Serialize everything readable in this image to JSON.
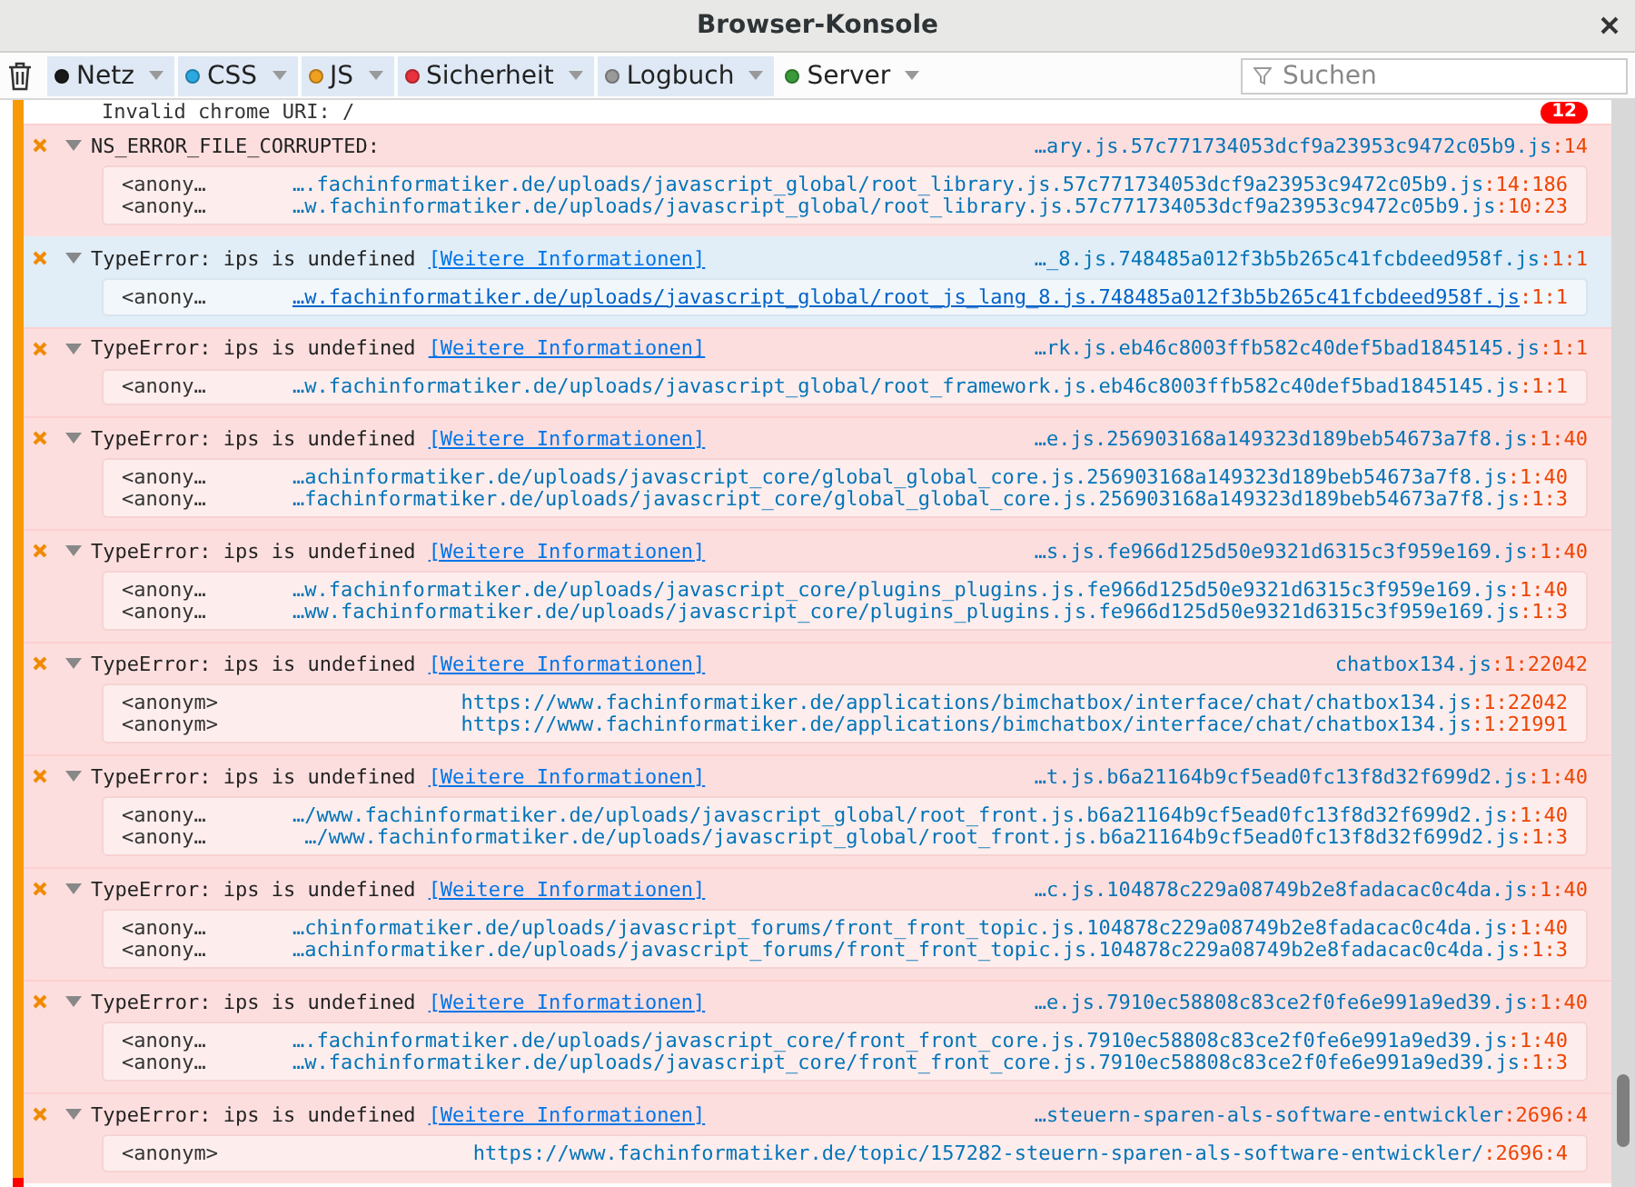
{
  "window": {
    "title": "Browser-Konsole"
  },
  "toolbar": {
    "filters": [
      {
        "label": "Netz",
        "color": "#1a1a1a",
        "selected": true
      },
      {
        "label": "CSS",
        "color": "#2aa8e0",
        "selected": true
      },
      {
        "label": "JS",
        "color": "#f0a020",
        "selected": true
      },
      {
        "label": "Sicherheit",
        "color": "#e8323c",
        "selected": true
      },
      {
        "label": "Logbuch",
        "color": "#9a9a9a",
        "selected": true
      },
      {
        "label": "Server",
        "color": "#3a9a3a",
        "selected": false
      }
    ],
    "search": {
      "placeholder": "Suchen"
    }
  },
  "previous_message": {
    "text": "Invalid chrome URI: /",
    "count": "12"
  },
  "messages": [
    {
      "text": "NS_ERROR_FILE_CORRUPTED:",
      "selected": false,
      "location": {
        "file": "…ary.js.57c771734053dcf9a23953c9472c05b9.js",
        "pos": ":14"
      },
      "stack": [
        {
          "function": "<anony…",
          "file": "….fachinformatiker.de/uploads/javascript_global/root_library.js.57c771734053dcf9a23953c9472c05b9.js",
          "pos": ":14:186"
        },
        {
          "function": "<anony…",
          "file": "…w.fachinformatiker.de/uploads/javascript_global/root_library.js.57c771734053dcf9a23953c9472c05b9.js",
          "pos": ":10:23"
        }
      ]
    },
    {
      "text": "TypeError: ips is undefined",
      "link": "[Weitere Informationen]",
      "selected": true,
      "location": {
        "file": "…_8.js.748485a012f3b5b265c41fcbdeed958f.js",
        "pos": ":1:1"
      },
      "stack": [
        {
          "function": "<anony…",
          "file": "…w.fachinformatiker.de/uploads/javascript_global/root_js_lang_8.js.748485a012f3b5b265c41fcbdeed958f.js",
          "pos": ":1:1"
        }
      ]
    },
    {
      "text": "TypeError: ips is undefined",
      "link": "[Weitere Informationen]",
      "selected": false,
      "location": {
        "file": "…rk.js.eb46c8003ffb582c40def5bad1845145.js",
        "pos": ":1:1"
      },
      "stack": [
        {
          "function": "<anony…",
          "file": "…w.fachinformatiker.de/uploads/javascript_global/root_framework.js.eb46c8003ffb582c40def5bad1845145.js",
          "pos": ":1:1"
        }
      ]
    },
    {
      "text": "TypeError: ips is undefined",
      "link": "[Weitere Informationen]",
      "selected": false,
      "location": {
        "file": "…e.js.256903168a149323d189beb54673a7f8.js",
        "pos": ":1:40"
      },
      "stack": [
        {
          "function": "<anony…",
          "file": "…achinformatiker.de/uploads/javascript_core/global_global_core.js.256903168a149323d189beb54673a7f8.js",
          "pos": ":1:40"
        },
        {
          "function": "<anony…",
          "file": "…fachinformatiker.de/uploads/javascript_core/global_global_core.js.256903168a149323d189beb54673a7f8.js",
          "pos": ":1:3"
        }
      ]
    },
    {
      "text": "TypeError: ips is undefined",
      "link": "[Weitere Informationen]",
      "selected": false,
      "location": {
        "file": "…s.js.fe966d125d50e9321d6315c3f959e169.js",
        "pos": ":1:40"
      },
      "stack": [
        {
          "function": "<anony…",
          "file": "…w.fachinformatiker.de/uploads/javascript_core/plugins_plugins.js.fe966d125d50e9321d6315c3f959e169.js",
          "pos": ":1:40"
        },
        {
          "function": "<anony…",
          "file": "…ww.fachinformatiker.de/uploads/javascript_core/plugins_plugins.js.fe966d125d50e9321d6315c3f959e169.js",
          "pos": ":1:3"
        }
      ]
    },
    {
      "text": "TypeError: ips is undefined",
      "link": "[Weitere Informationen]",
      "selected": false,
      "location": {
        "file": "chatbox134.js",
        "pos": ":1:22042"
      },
      "stack": [
        {
          "function": "<anonym>",
          "file": "https://www.fachinformatiker.de/applications/bimchatbox/interface/chat/chatbox134.js",
          "pos": ":1:22042"
        },
        {
          "function": "<anonym>",
          "file": "https://www.fachinformatiker.de/applications/bimchatbox/interface/chat/chatbox134.js",
          "pos": ":1:21991"
        }
      ]
    },
    {
      "text": "TypeError: ips is undefined",
      "link": "[Weitere Informationen]",
      "selected": false,
      "location": {
        "file": "…t.js.b6a21164b9cf5ead0fc13f8d32f699d2.js",
        "pos": ":1:40"
      },
      "stack": [
        {
          "function": "<anony…",
          "file": "…/www.fachinformatiker.de/uploads/javascript_global/root_front.js.b6a21164b9cf5ead0fc13f8d32f699d2.js",
          "pos": ":1:40"
        },
        {
          "function": "<anony…",
          "file": "…/www.fachinformatiker.de/uploads/javascript_global/root_front.js.b6a21164b9cf5ead0fc13f8d32f699d2.js",
          "pos": ":1:3"
        }
      ]
    },
    {
      "text": "TypeError: ips is undefined",
      "link": "[Weitere Informationen]",
      "selected": false,
      "location": {
        "file": "…c.js.104878c229a08749b2e8fadacac0c4da.js",
        "pos": ":1:40"
      },
      "stack": [
        {
          "function": "<anony…",
          "file": "…chinformatiker.de/uploads/javascript_forums/front_front_topic.js.104878c229a08749b2e8fadacac0c4da.js",
          "pos": ":1:40"
        },
        {
          "function": "<anony…",
          "file": "…achinformatiker.de/uploads/javascript_forums/front_front_topic.js.104878c229a08749b2e8fadacac0c4da.js",
          "pos": ":1:3"
        }
      ]
    },
    {
      "text": "TypeError: ips is undefined",
      "link": "[Weitere Informationen]",
      "selected": false,
      "location": {
        "file": "…e.js.7910ec58808c83ce2f0fe6e991a9ed39.js",
        "pos": ":1:40"
      },
      "stack": [
        {
          "function": "<anony…",
          "file": "….fachinformatiker.de/uploads/javascript_core/front_front_core.js.7910ec58808c83ce2f0fe6e991a9ed39.js",
          "pos": ":1:40"
        },
        {
          "function": "<anony…",
          "file": "…w.fachinformatiker.de/uploads/javascript_core/front_front_core.js.7910ec58808c83ce2f0fe6e991a9ed39.js",
          "pos": ":1:3"
        }
      ]
    },
    {
      "text": "TypeError: ips is undefined",
      "link": "[Weitere Informationen]",
      "selected": false,
      "location": {
        "file": "…steuern-sparen-als-software-entwickler",
        "pos": ":2696:4"
      },
      "stack": [
        {
          "function": "<anonym>",
          "file": "https://www.fachinformatiker.de/topic/157282-steuern-sparen-als-software-entwickler/",
          "pos": ":2696:4"
        }
      ]
    }
  ]
}
